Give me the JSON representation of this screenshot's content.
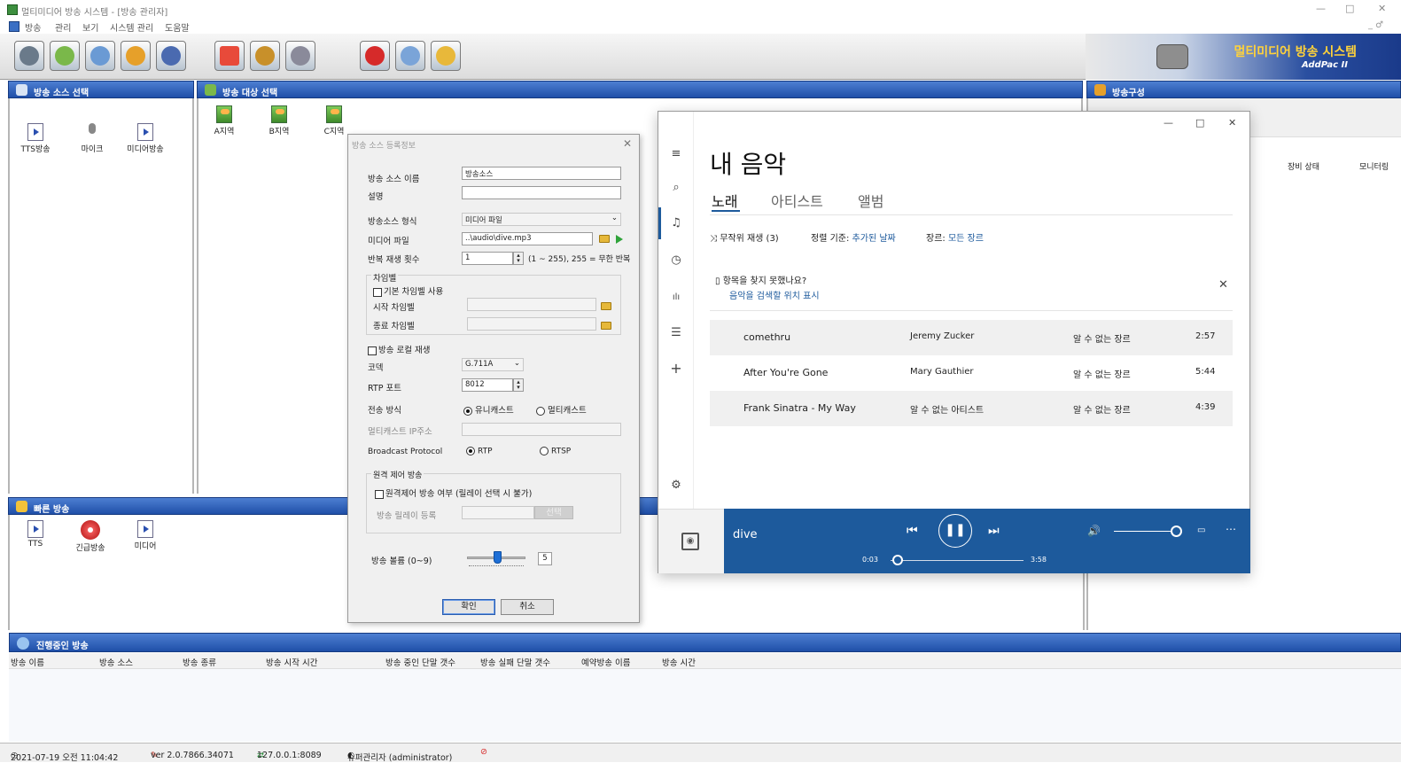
{
  "window": {
    "title": "멀티미디어 방송 시스템 - [방송 관리자]",
    "minimize": "—",
    "restore": "□",
    "close": "✕",
    "mdi": "_ ♂"
  },
  "menu": [
    "방송",
    "관리",
    "보기",
    "시스템 관리",
    "도움말"
  ],
  "brand": {
    "title": "멀티미디어 방송 시스템",
    "subtitle": "AddPac II"
  },
  "source_panel": {
    "title": "방송 소스 선택",
    "items": [
      "TTS방송",
      "마이크",
      "미디어방송"
    ]
  },
  "target_panel": {
    "title": "방송 대상 선택",
    "items": [
      "A지역",
      "B지역",
      "C지역"
    ]
  },
  "config_panel": {
    "title": "방송구성",
    "columns": [
      "장비 상태",
      "모니터링"
    ]
  },
  "quick_panel": {
    "title": "빠른 방송",
    "items": [
      "TTS",
      "긴급방송",
      "미디어"
    ]
  },
  "dialog": {
    "title": "방송 소스 등록정보",
    "close": "✕",
    "name_label": "방송 소스 이름",
    "name_value": "방송소스",
    "desc_label": "설명",
    "desc_value": "",
    "type_label": "방송소스 형식",
    "type_value": "미디어 파일",
    "file_label": "미디어 파일",
    "file_value": "..\\audio\\dive.mp3",
    "repeat_label": "반복 재생 횟수",
    "repeat_value": "1",
    "repeat_hint": "(1 ~ 255), 255 = 무한 반복",
    "chime_group": "차임벨",
    "chime_default": "기본 차임벨 사용",
    "chime_start": "시작 차임벨",
    "chime_end": "종료 차임벨",
    "local_play": "방송 로컬 재생",
    "codec_label": "코덱",
    "codec_value": "G.711A",
    "rtp_label": "RTP 포트",
    "rtp_value": "8012",
    "tx_label": "전송 방식",
    "tx_unicast": "유니캐스트",
    "tx_multicast": "멀티캐스트",
    "mcast_label": "멀티캐스트 IP주소",
    "proto_label": "Broadcast Protocol",
    "proto_rtp": "RTP",
    "proto_rtsp": "RTSP",
    "remote_group": "원격 제어 방송",
    "remote_check": "원격제어 방송 여부 (릴레이 선택 시 불가)",
    "relay_label": "방송 릴레이 등록",
    "relay_btn": "선택",
    "volume_label": "방송 볼륨 (0~9)",
    "volume_value": "5",
    "volume_level": 0.55,
    "ok": "확인",
    "cancel": "취소"
  },
  "music": {
    "title": "내 음악",
    "tabs": [
      "노래",
      "아티스트",
      "앨범"
    ],
    "shuffle": "무작위 재생 (3)",
    "sort_label": "정렬 기준:",
    "sort_value": "추가된 날짜",
    "genre_label": "장르:",
    "genre_value": "모든 장르",
    "notice_title": "항목을 찾지 못했나요?",
    "notice_link": "음악을 검색할 위치 표시",
    "songs": [
      {
        "title": "comethru",
        "artist": "Jeremy Zucker",
        "genre": "알 수 없는 장르",
        "duration": "2:57"
      },
      {
        "title": "After You're Gone",
        "artist": "Mary Gauthier",
        "genre": "알 수 없는 장르",
        "duration": "5:44"
      },
      {
        "title": "Frank Sinatra - My Way",
        "artist": "알 수 없는 아티스트",
        "genre": "알 수 없는 장르",
        "duration": "4:39"
      }
    ],
    "now_playing": "dive",
    "elapsed": "0:03",
    "total": "3:58",
    "progress": 0.013,
    "win_min": "—",
    "win_max": "□",
    "win_close": "✕"
  },
  "running": {
    "title": "진행중인 방송",
    "columns": [
      "방송 이름",
      "방송 소스",
      "방송 종류",
      "방송 시작 시간",
      "방송 중인 단말 갯수",
      "방송 실패 단말 갯수",
      "예약방송 이름",
      "방송 시간"
    ]
  },
  "status": {
    "datetime": "2021-07-19 오전 11:04:42",
    "version": "ver 2.0.7866.34071",
    "server": "127.0.0.1:8089",
    "user": "슈퍼관리자 (administrator)"
  }
}
